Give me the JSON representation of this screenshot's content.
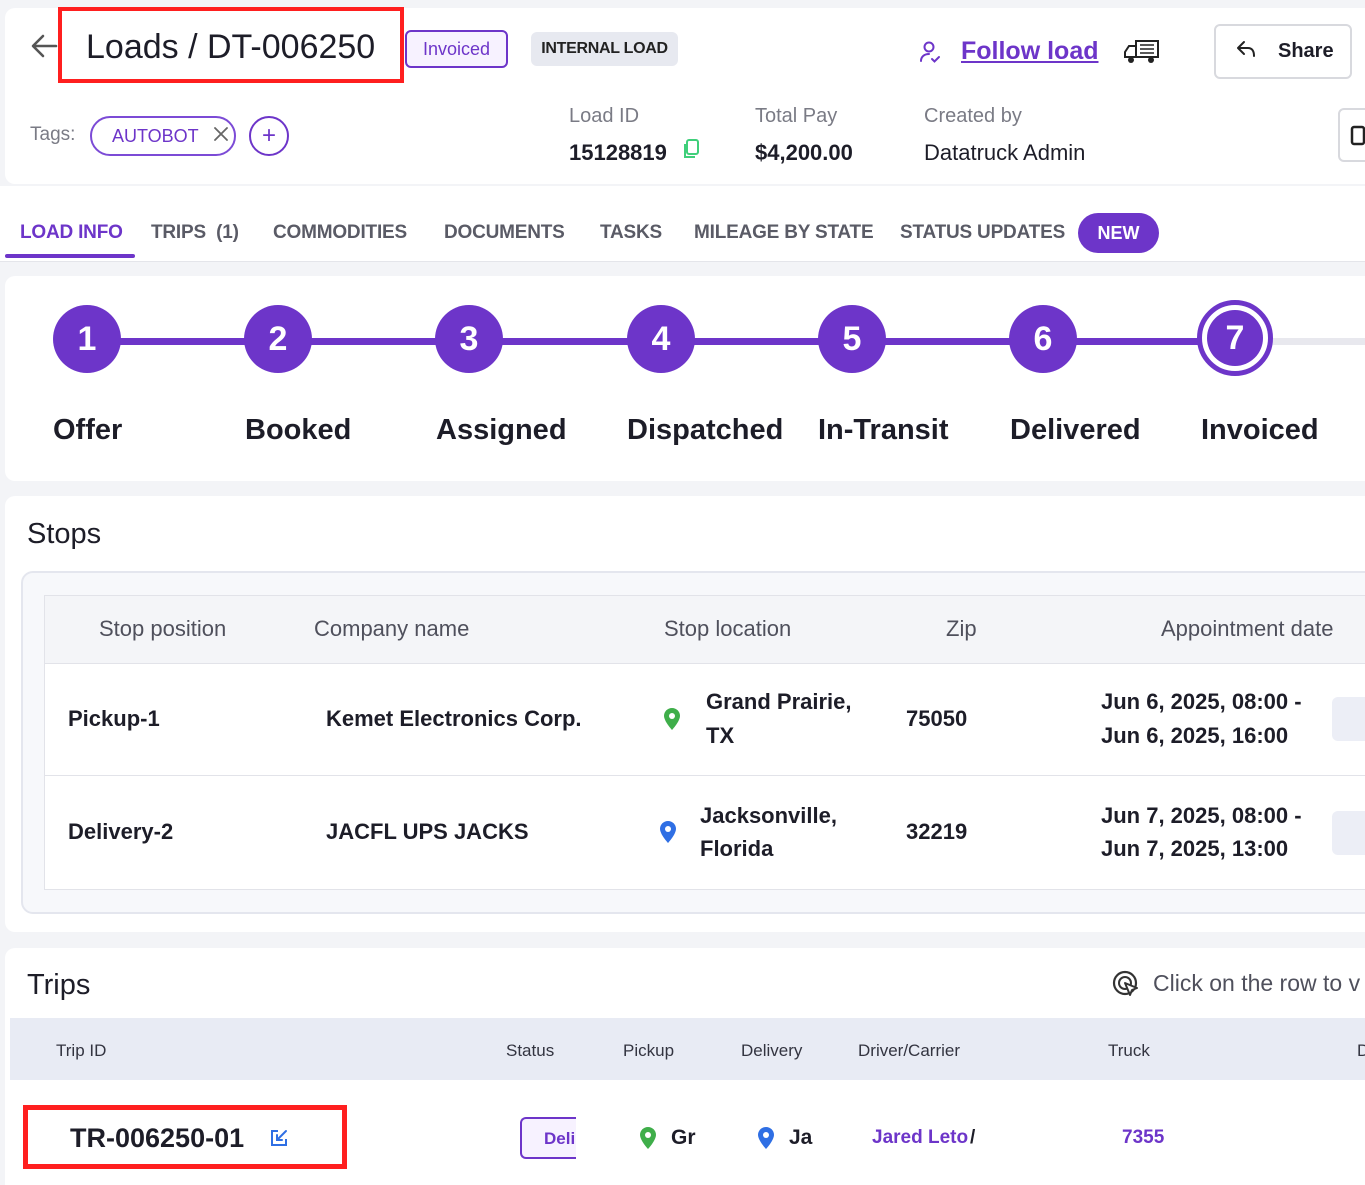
{
  "header": {
    "title": "Loads / DT-006250",
    "status": "Invoiced",
    "load_type": "INTERNAL LOAD",
    "follow_label": "Follow load",
    "share_label": "Share",
    "tags_label": "Tags:",
    "tags": [
      "AUTOBOT"
    ],
    "add_tag": "+",
    "meta": {
      "load_id_label": "Load ID",
      "load_id": "15128819",
      "total_pay_label": "Total Pay",
      "total_pay": "$4,200.00",
      "created_by_label": "Created by",
      "created_by": "Datatruck Admin"
    }
  },
  "tabs": [
    {
      "label": "LOAD INFO",
      "active": true
    },
    {
      "label": "TRIPS  (1)"
    },
    {
      "label": "COMMODITIES"
    },
    {
      "label": "DOCUMENTS"
    },
    {
      "label": "TASKS"
    },
    {
      "label": "MILEAGE BY STATE"
    },
    {
      "label": "STATUS UPDATES"
    }
  ],
  "new_badge": "NEW",
  "progress": {
    "current_step": 7,
    "steps": [
      {
        "num": "1",
        "label": "Offer"
      },
      {
        "num": "2",
        "label": "Booked"
      },
      {
        "num": "3",
        "label": "Assigned"
      },
      {
        "num": "4",
        "label": "Dispatched"
      },
      {
        "num": "5",
        "label": "In-Transit"
      },
      {
        "num": "6",
        "label": "Delivered"
      },
      {
        "num": "7",
        "label": "Invoiced"
      }
    ]
  },
  "stops": {
    "title": "Stops",
    "columns": [
      "Stop position",
      "Company name",
      "Stop location",
      "Zip",
      "Appointment date"
    ],
    "rows": [
      {
        "position": "Pickup-1",
        "company": "Kemet Electronics Corp.",
        "location_line1": "Grand Prairie,",
        "location_line2": "TX",
        "zip": "75050",
        "appt_line1": "Jun 6, 2025, 08:00 -",
        "appt_line2": "Jun 6, 2025, 16:00",
        "pin_color": "#3fae4a"
      },
      {
        "position": "Delivery-2",
        "company": "JACFL UPS JACKS",
        "location_line1": "Jacksonville,",
        "location_line2": "Florida",
        "zip": "32219",
        "appt_line1": "Jun 7, 2025, 08:00 -",
        "appt_line2": "Jun 7, 2025, 13:00",
        "pin_color": "#2f6fe4"
      }
    ]
  },
  "trips": {
    "title": "Trips",
    "hint": "Click on the row to v",
    "columns": [
      "Trip ID",
      "Status",
      "Pickup",
      "Delivery",
      "Driver/Carrier",
      "Truck",
      "D"
    ],
    "rows": [
      {
        "trip_id": "TR-006250-01",
        "status": "Deli",
        "pickup": "Gr",
        "delivery": "Ja",
        "driver": "Jared Leto",
        "separator": "/",
        "truck": "7355"
      }
    ]
  },
  "colors": {
    "accent": "#6d35c9",
    "highlight": "#ff1f1f",
    "pickup_pin": "#3fae4a",
    "delivery_pin": "#2f6fe4"
  }
}
